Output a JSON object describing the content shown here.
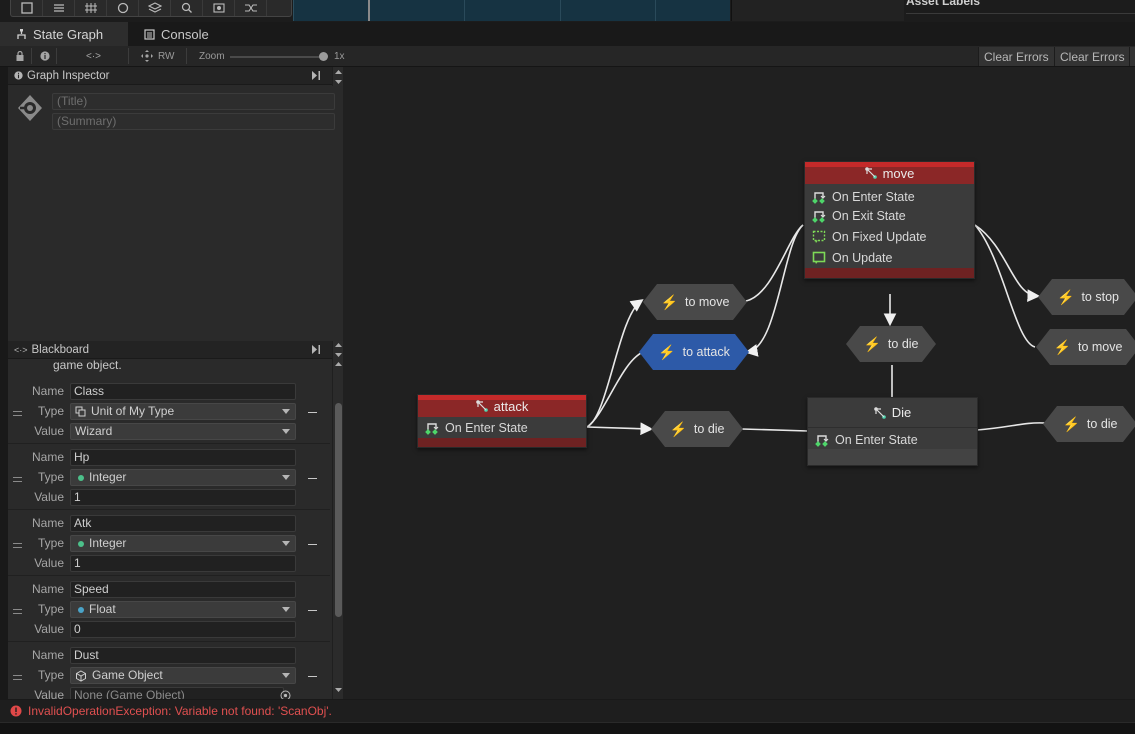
{
  "top": {
    "tools": [
      "rect-tool-icon",
      "transform-tool-icon",
      "grid-tool-icon",
      "orbit-tool-icon",
      "layers-tool-icon",
      "search-tool-icon",
      "visibility-tool-icon",
      "shuffle-tool-icon"
    ],
    "asset_labels": "Asset Labels"
  },
  "tabs": [
    {
      "label": "State Graph",
      "icon": "state-graph-icon"
    },
    {
      "label": "Console",
      "icon": "console-icon"
    }
  ],
  "toolbar": {
    "rw_label": "RW",
    "zoom_label": "Zoom",
    "zoom_value": "1x",
    "zoom_level": 1.0,
    "clear_errors_1": "Clear Errors",
    "clear_errors_2": "Clear Errors"
  },
  "inspector": {
    "title": "Graph Inspector",
    "title_placeholder": "(Title)",
    "summary_placeholder": "(Summary)"
  },
  "blackboard": {
    "title": "Blackboard",
    "overflow_text": "game object.",
    "labels": {
      "name": "Name",
      "type": "Type",
      "value": "Value"
    },
    "variables": [
      {
        "name": "Class",
        "type": "Unit of My Type",
        "value": "Wizard",
        "value_kind": "dropdown",
        "type_icon": "unit-type-icon"
      },
      {
        "name": "Hp",
        "type": "Integer",
        "value": "1",
        "value_kind": "text",
        "type_icon": "integer-dot-icon",
        "dot_color": "#4cc08a"
      },
      {
        "name": "Atk",
        "type": "Integer",
        "value": "1",
        "value_kind": "text",
        "type_icon": "integer-dot-icon",
        "dot_color": "#4cc08a"
      },
      {
        "name": "Speed",
        "type": "Float",
        "value": "0",
        "value_kind": "text",
        "type_icon": "float-dot-icon",
        "dot_color": "#4aa3c8"
      },
      {
        "name": "Dust",
        "type": "Game Object",
        "value": "None (Game Object)",
        "value_kind": "object",
        "type_icon": "cube-icon"
      }
    ]
  },
  "graph": {
    "states": {
      "attack": {
        "title": "attack",
        "events": [
          "On Enter State"
        ]
      },
      "move": {
        "title": "move",
        "events": [
          "On Enter State",
          "On Exit State",
          "On Fixed Update",
          "On Update"
        ]
      },
      "die": {
        "title": "Die",
        "events": [
          "On Enter State"
        ]
      }
    },
    "transitions": {
      "to_move_left": "to move",
      "to_attack": "to attack",
      "to_die_attack": "to die",
      "to_die_move": "to die",
      "to_stop": "to stop",
      "to_move_right": "to move",
      "to_die_right": "to die"
    }
  },
  "status": {
    "error": "InvalidOperationException: Variable not found: 'ScanObj'."
  },
  "colors": {
    "state_header_red": "#8b2727",
    "state_header_dark": "#3b3b3b",
    "transition": "#494949",
    "transition_selected": "#2d5aa8",
    "bolt": "#f2d336",
    "error": "#e05050"
  }
}
